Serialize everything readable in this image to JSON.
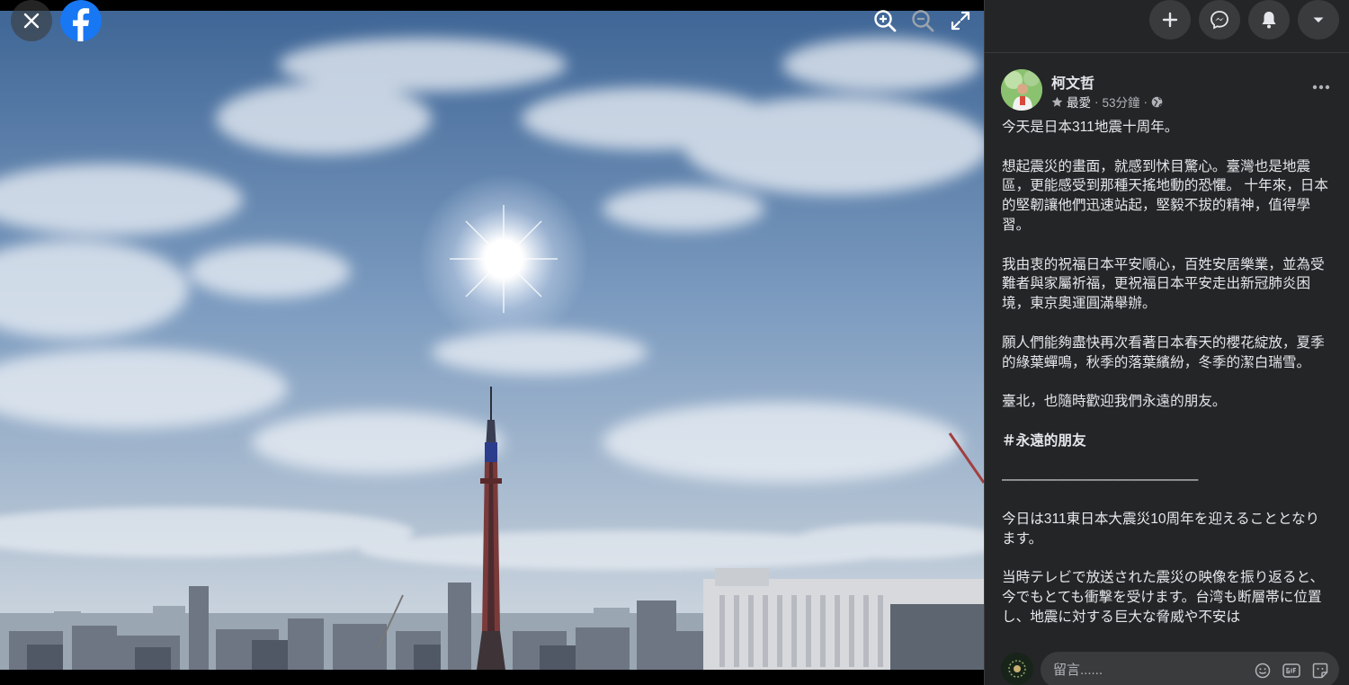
{
  "viewer": {
    "close_icon": "close-icon",
    "logo_icon": "facebook-logo-icon",
    "zoom_in_icon": "zoom-in-icon",
    "zoom_out_icon": "zoom-out-icon",
    "fullscreen_icon": "fullscreen-icon"
  },
  "header_actions": {
    "create_icon": "plus-icon",
    "messenger_icon": "messenger-icon",
    "notifications_icon": "bell-icon",
    "account_icon": "caret-down-icon"
  },
  "post": {
    "author": "柯文哲",
    "audience": "最愛",
    "time": "53分鐘",
    "privacy_icon": "globe-icon",
    "more_icon": "more-horizontal-icon",
    "paragraphs": [
      "今天是日本311地震十周年。",
      "想起震災的畫面，就感到怵目驚心。臺灣也是地震區，更能感受到那種天搖地動的恐懼。 十年來，日本的堅韌讓他們迅速站起，堅毅不拔的精神，值得學習。",
      "我由衷的祝福日本平安順心，百姓安居樂業，並為受難者與家屬祈福，更祝福日本平安走出新冠肺炎困境，東京奧運圓滿舉辦。",
      "願人們能夠盡快再次看著日本春天的櫻花綻放，夏季的綠葉蟬鳴，秋季的落葉繽紛，冬季的潔白瑞雪。",
      "臺北，也隨時歡迎我們永遠的朋友。"
    ],
    "hashtag": "＃永遠的朋友",
    "separator": "——————————————",
    "japanese_paragraphs": [
      "今日は311東日本大震災10周年を迎えることとなります。",
      "当時テレビで放送された震災の映像を振り返ると、今でもとても衝撃を受けます。台湾も断層帯に位置し、地震に対する巨大な脅威や不安は"
    ]
  },
  "comment": {
    "placeholder": "留言......",
    "emoji_icon": "emoji-icon",
    "gif_icon": "gif-icon",
    "sticker_icon": "sticker-icon"
  }
}
